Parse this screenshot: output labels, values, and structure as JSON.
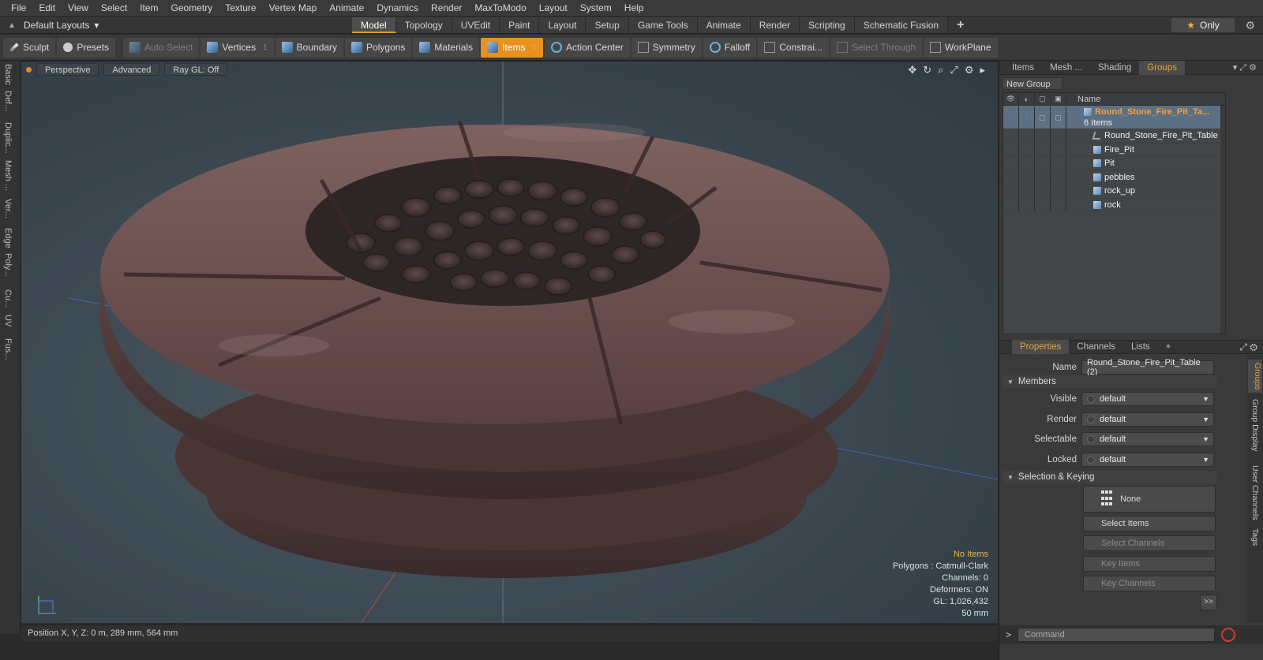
{
  "menu": [
    "File",
    "Edit",
    "View",
    "Select",
    "Item",
    "Geometry",
    "Texture",
    "Vertex Map",
    "Animate",
    "Dynamics",
    "Render",
    "MaxToModo",
    "Layout",
    "System",
    "Help"
  ],
  "layout": {
    "selector": "Default Layouts",
    "tabs": [
      "Model",
      "Topology",
      "UVEdit",
      "Paint",
      "Layout",
      "Setup",
      "Game Tools",
      "Animate",
      "Render",
      "Scripting",
      "Schematic Fusion"
    ],
    "active_tab": "Model",
    "only_label": "Only"
  },
  "toolbar": {
    "sculpt": "Sculpt",
    "presets": "Presets",
    "auto_select": "Auto Select",
    "vertices": "Vertices",
    "vertices_count": "1",
    "boundary": "Boundary",
    "polygons": "Polygons",
    "materials": "Materials",
    "items": "Items",
    "items_count": "5",
    "action_center": "Action Center",
    "symmetry": "Symmetry",
    "falloff": "Falloff",
    "constrain": "Constrai...",
    "select_through": "Select Through",
    "workplane": "WorkPlane"
  },
  "left_tabs": [
    "Basic",
    "Def...",
    "Duplic...",
    "Mesh ...",
    "Ver...",
    "Edge",
    "Poly...",
    "Cu...",
    "UV",
    "Fus..."
  ],
  "viewport": {
    "perspective": "Perspective",
    "advanced": "Advanced",
    "raygl": "Ray GL: Off",
    "info": {
      "no_items": "No Items",
      "polygons": "Polygons : Catmull-Clark",
      "channels": "Channels: 0",
      "deformers": "Deformers: ON",
      "gl": "GL: 1,026,432",
      "focal": "50 mm"
    }
  },
  "status": {
    "position": "Position X, Y, Z:   0 m, 289 mm, 564 mm"
  },
  "groups_panel": {
    "tabs": [
      "Items",
      "Mesh ...",
      "Shading",
      "Groups"
    ],
    "active_tab": "Groups",
    "new_group": "New Group",
    "col_name": "Name",
    "root": {
      "name": "Round_Stone_Fire_Pit_Ta...",
      "count": "6 Items"
    },
    "children": [
      "Round_Stone_Fire_Pit_Table",
      "Fire_Pit",
      "Pit",
      "pebbles",
      "rock_up",
      "rock"
    ]
  },
  "properties": {
    "tabs": [
      "Properties",
      "Channels",
      "Lists"
    ],
    "active_tab": "Properties",
    "name_label": "Name",
    "name_value": "Round_Stone_Fire_Pit_Table (2)",
    "members": "Members",
    "rows": [
      {
        "label": "Visible",
        "value": "default"
      },
      {
        "label": "Render",
        "value": "default"
      },
      {
        "label": "Selectable",
        "value": "default"
      },
      {
        "label": "Locked",
        "value": "default"
      }
    ],
    "selection_keying": "Selection & Keying",
    "none": "None",
    "select_items": "Select Items",
    "select_channels": "Select Channels",
    "key_items": "Key Items",
    "key_channels": "Key Channels",
    "more": ">>",
    "side_tabs": [
      "Groups",
      "Group Display",
      "User Channels",
      "Tags"
    ]
  },
  "command": {
    "placeholder": "Command"
  }
}
